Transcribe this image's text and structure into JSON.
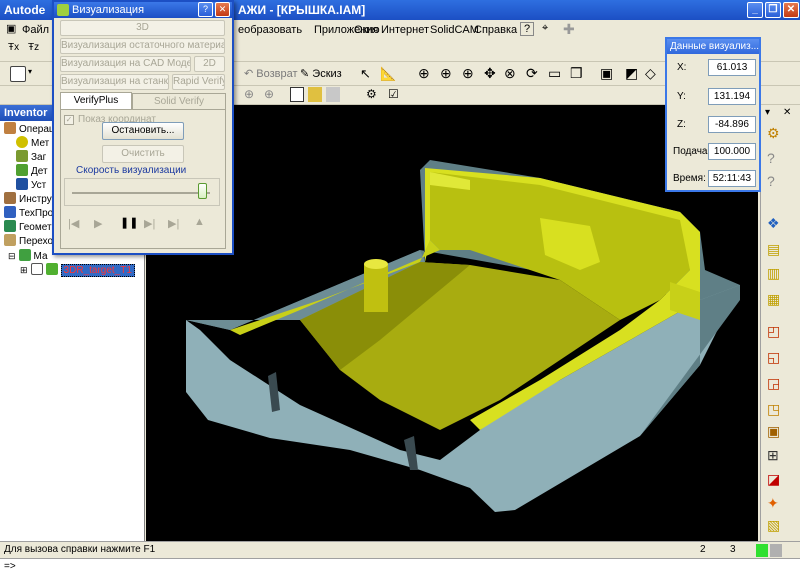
{
  "window": {
    "title_left": "Autode",
    "title_right": "АЖИ - [КРЫШКА.IAM]"
  },
  "menu": {
    "file": "Файл",
    "transform": "еобразовать",
    "apps": "Приложения",
    "window": "Окно",
    "internet": "Интернет",
    "solidcam": "SolidCAM",
    "help": "Справка"
  },
  "toolbar": {
    "return_label": "Возврат",
    "sketch_label": "Эскиз"
  },
  "browser": {
    "header": "Inventor",
    "items": [
      {
        "label": "Операци"
      },
      {
        "label": "Мет"
      },
      {
        "label": "Заг"
      },
      {
        "label": "Дет"
      },
      {
        "label": "Уст"
      },
      {
        "label": "Инструм"
      },
      {
        "label": "ТехПроц"
      },
      {
        "label": "Геометр"
      },
      {
        "label": "Перехо"
      },
      {
        "label": "Ма"
      },
      {
        "label": "3DR_target_T1"
      }
    ]
  },
  "viz_dialog": {
    "title": "Визуализация",
    "btn_3d": "3D",
    "btn_residual": "Визуализация остаточного материала",
    "btn_cad": "Визуализация на CAD Модели",
    "btn_2d": "2D",
    "btn_machine": "Визуализация на станке",
    "btn_rapid": "Rapid Verify",
    "tab_verifyplus": "VerifyPlus",
    "tab_solidverify": "Solid Verify",
    "show_coords": "Показ координат",
    "btn_stop": "Остановить...",
    "btn_clear": "Очистить",
    "speed_label": "Скорость визуализации"
  },
  "data_window": {
    "title": "Данные визуализ...",
    "x_label": "X:",
    "x_value": "61.013",
    "y_label": "Y:",
    "y_value": "131.194",
    "z_label": "Z:",
    "z_value": "-84.896",
    "feed_label": "Подача:",
    "feed_value": "100.000",
    "time_label": "Время:",
    "time_value": "52:11:43"
  },
  "status": {
    "hint": "Для вызова справки нажмите F1",
    "field1": "2",
    "field2": "3",
    "prompt": "=>"
  },
  "colors": {
    "titlebar": "#1c4fc4",
    "part_yellow": "#d8e020",
    "stock_blue": "#8fb0b8"
  }
}
